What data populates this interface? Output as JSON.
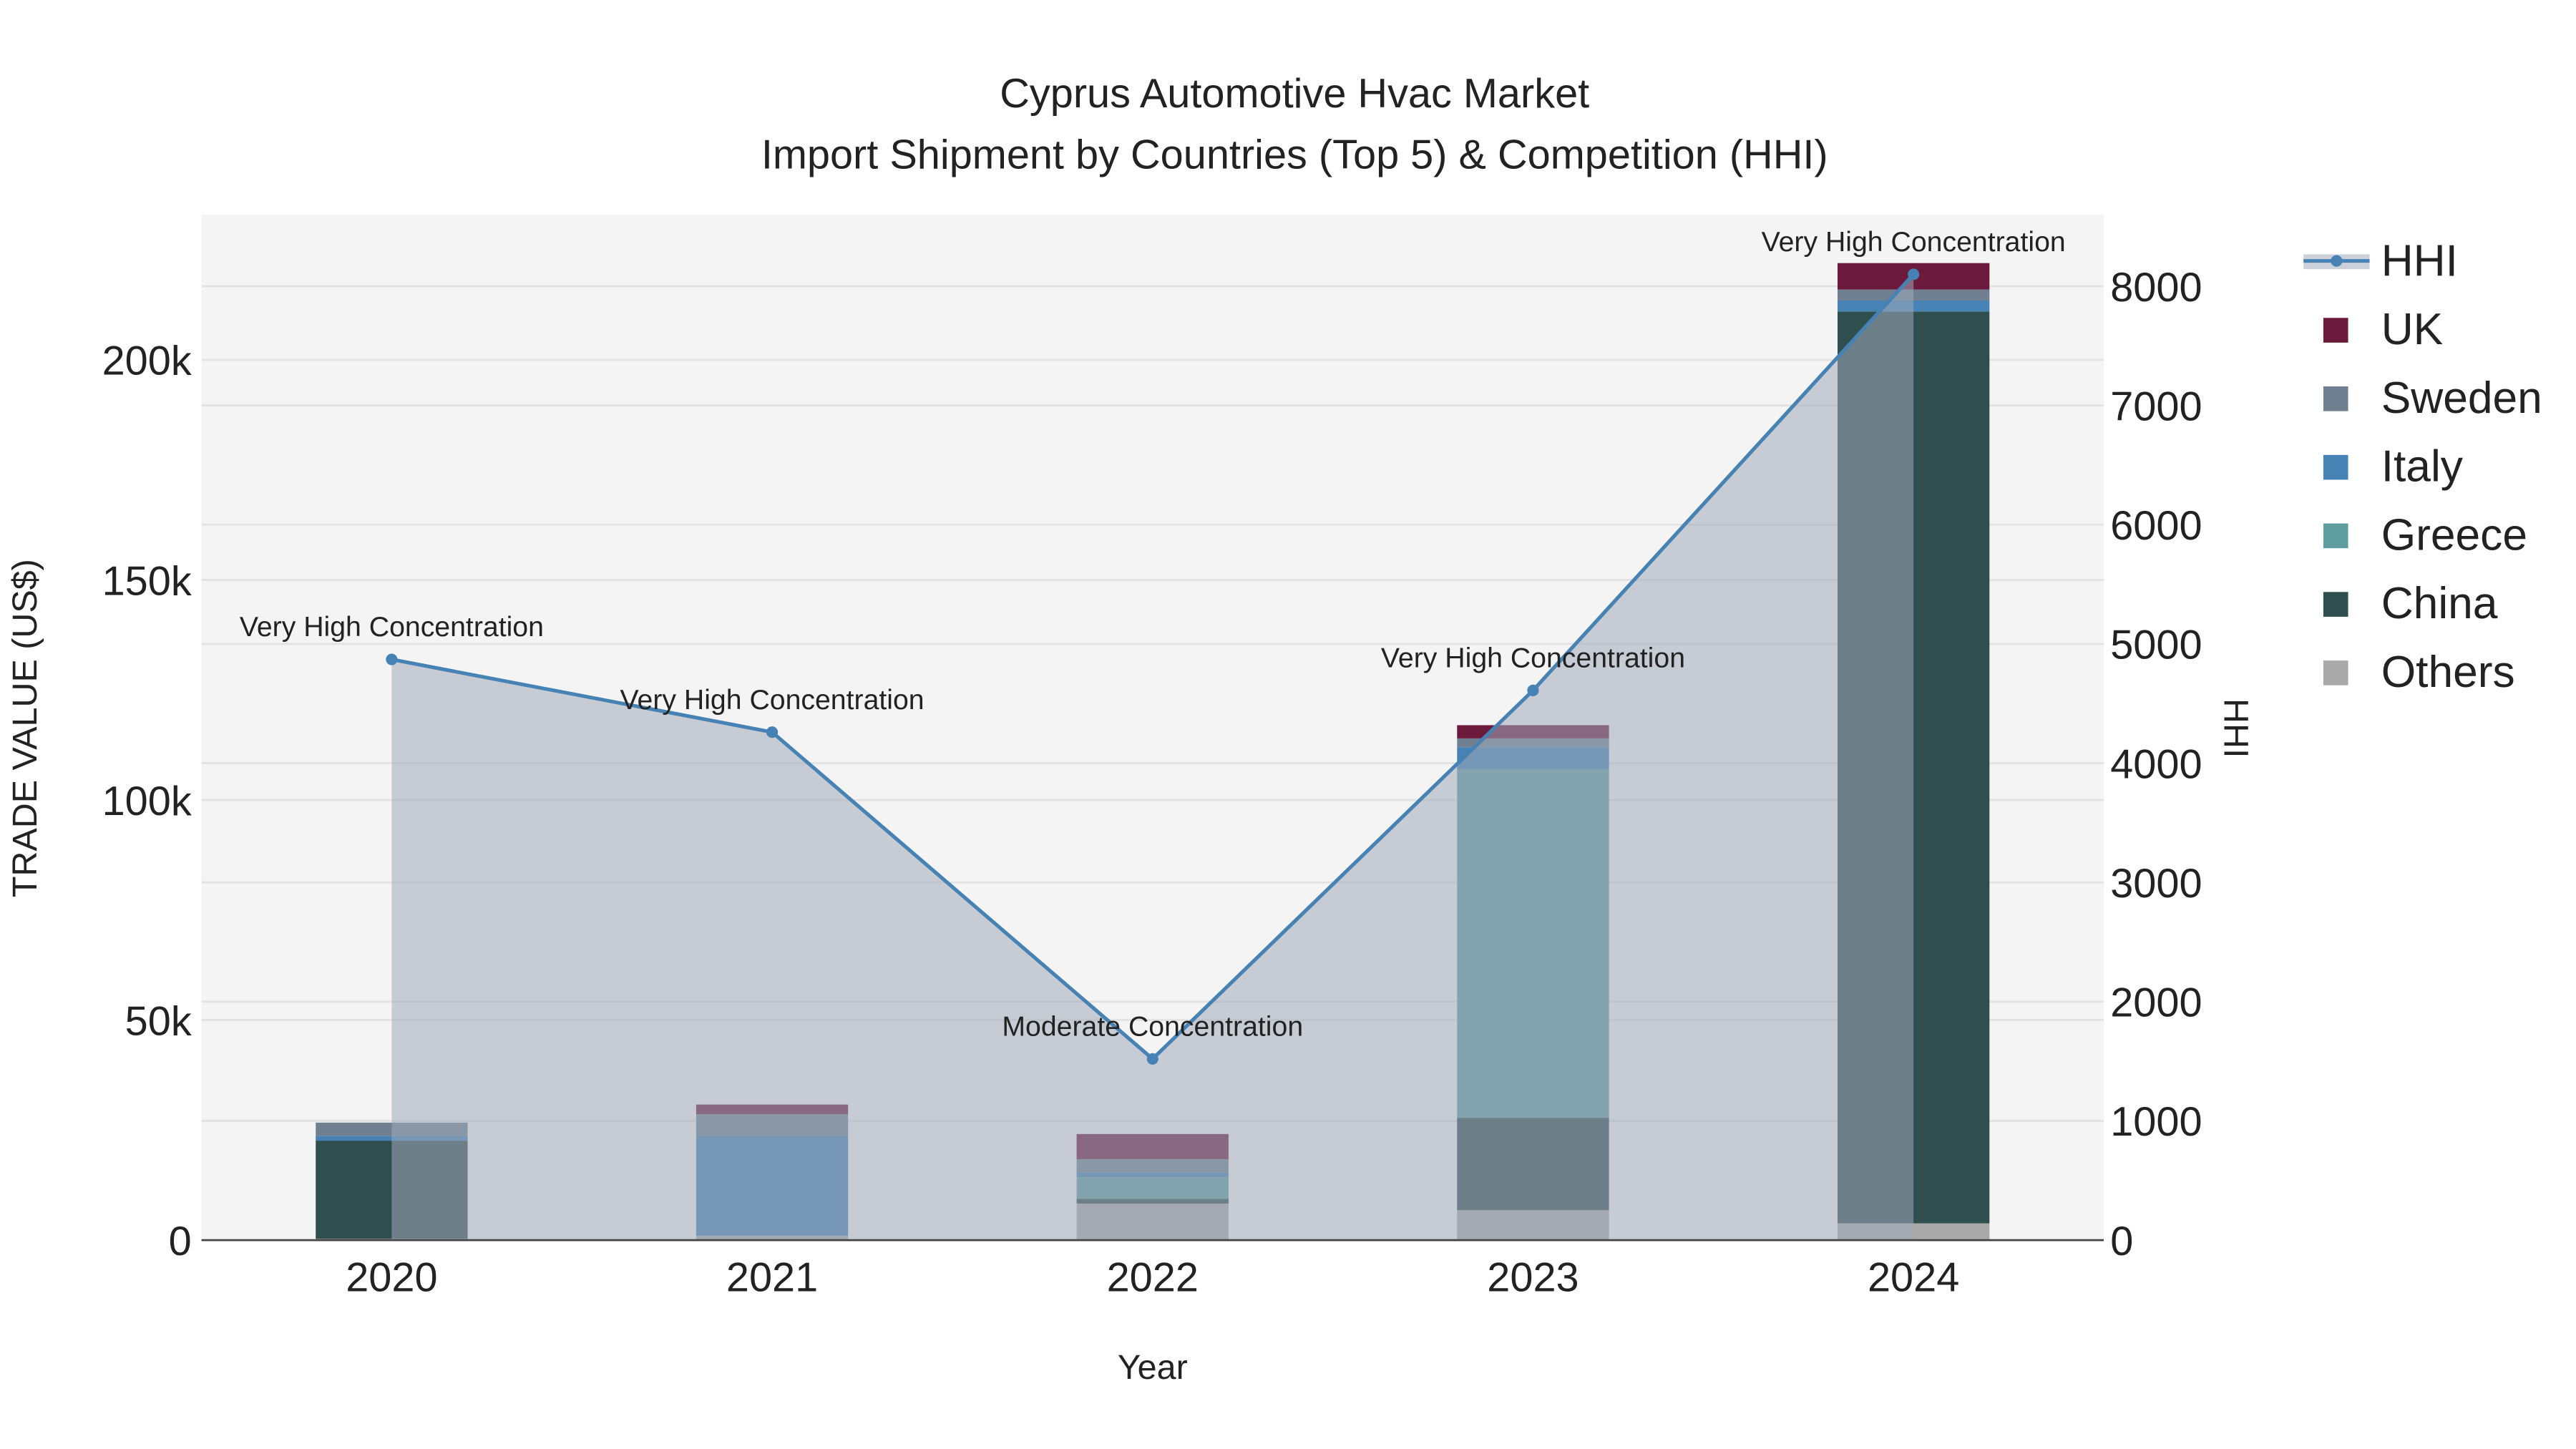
{
  "chart_data": {
    "type": "bar",
    "title": "Cyprus Automotive Hvac Market",
    "subtitle": "Import Shipment by Countries (Top 5) & Competition (HHI)",
    "xlabel": "Year",
    "ylabel": "TRADE VALUE (US$)",
    "y2label": "HHI",
    "categories": [
      "2020",
      "2021",
      "2022",
      "2023",
      "2024"
    ],
    "ylim": [
      0,
      233000
    ],
    "y2lim": [
      0,
      8600
    ],
    "yticks": [
      {
        "v": 0,
        "label": "0"
      },
      {
        "v": 50000,
        "label": "50k"
      },
      {
        "v": 100000,
        "label": "100k"
      },
      {
        "v": 150000,
        "label": "150k"
      },
      {
        "v": 200000,
        "label": "200k"
      }
    ],
    "y2ticks": [
      0,
      1000,
      2000,
      3000,
      4000,
      5000,
      6000,
      7000,
      8000
    ],
    "stacked": true,
    "series": [
      {
        "name": "Others",
        "color": "#a9a9a9",
        "values": [
          300,
          1000,
          8300,
          6800,
          3800
        ]
      },
      {
        "name": "China",
        "color": "#2f4f4f",
        "values": [
          22300,
          0,
          1100,
          21000,
          207200
        ]
      },
      {
        "name": "Greece",
        "color": "#5f9ea0",
        "values": [
          0,
          0,
          4900,
          79200,
          0
        ]
      },
      {
        "name": "Italy",
        "color": "#4682b4",
        "values": [
          1100,
          22700,
          1100,
          5000,
          2500
        ]
      },
      {
        "name": "Sweden",
        "color": "#708090",
        "values": [
          3000,
          4900,
          3000,
          2000,
          2500
        ]
      },
      {
        "name": "UK",
        "color": "#6b1a3c",
        "values": [
          0,
          2200,
          5700,
          3000,
          6000
        ]
      }
    ],
    "hhi": {
      "name": "HHI",
      "color": "#4682b4",
      "values": [
        4870,
        4260,
        1520,
        4610,
        8100
      ],
      "annotations": [
        "Very High Concentration",
        "Very High Concentration",
        "Moderate Concentration",
        "Very High Concentration",
        "Very High Concentration"
      ]
    },
    "legend": {
      "placement": "right",
      "order": [
        "HHI",
        "UK",
        "Sweden",
        "Italy",
        "Greece",
        "China",
        "Others"
      ]
    },
    "grid": true
  }
}
